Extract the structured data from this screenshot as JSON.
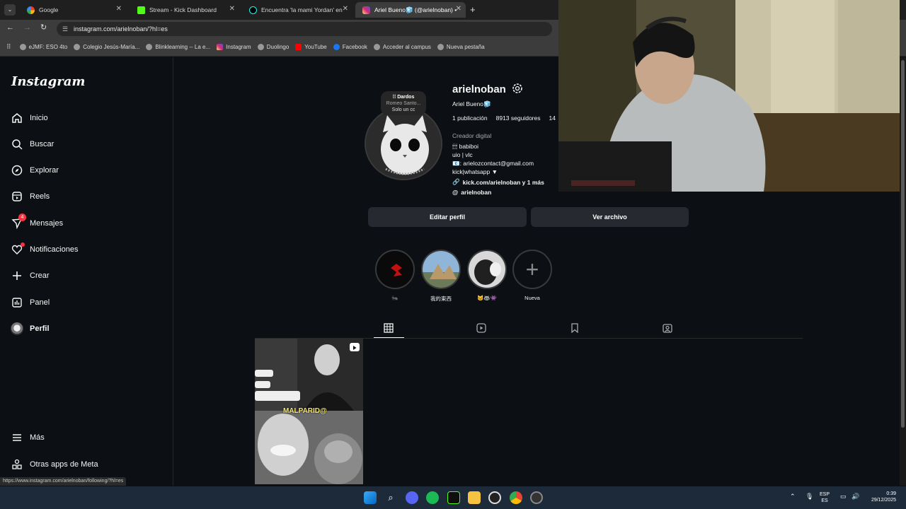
{
  "browser": {
    "tabs": [
      {
        "title": "Google",
        "favicon": "google-icon",
        "active": false
      },
      {
        "title": "Stream - Kick Dashboard",
        "favicon": "kick-icon",
        "active": false
      },
      {
        "title": "Encuentra 'la mami Yordan' en",
        "favicon": "tiktok-icon",
        "active": false
      },
      {
        "title": "Ariel Bueno🧊 (@arielnoban) •",
        "favicon": "instagram-icon",
        "active": true
      }
    ],
    "url": "instagram.com/arielnoban/?hl=es",
    "bookmarks": [
      "eJMF: ESO 4to",
      "Colegio Jesús-María...",
      "Blinklearning -- La e...",
      "Instagram",
      "Duolingo",
      "YouTube",
      "Facebook",
      "Acceder al campus",
      "Nueva pestaña"
    ],
    "status_url": "https://www.instagram.com/arielnoban/following/?hl=es"
  },
  "sidebar": {
    "logo": "Instagram",
    "items": [
      {
        "label": "Inicio",
        "icon": "home-icon"
      },
      {
        "label": "Buscar",
        "icon": "search-icon"
      },
      {
        "label": "Explorar",
        "icon": "compass-icon"
      },
      {
        "label": "Reels",
        "icon": "reels-icon"
      },
      {
        "label": "Mensajes",
        "icon": "messenger-icon",
        "badge": "4"
      },
      {
        "label": "Notificaciones",
        "icon": "heart-icon"
      },
      {
        "label": "Crear",
        "icon": "plus-icon"
      },
      {
        "label": "Panel",
        "icon": "chart-icon"
      },
      {
        "label": "Perfil",
        "icon": "avatar-icon"
      }
    ],
    "bottom": [
      {
        "label": "Más",
        "icon": "menu-icon"
      },
      {
        "label": "Otras apps de Meta",
        "icon": "meta-apps-icon"
      }
    ]
  },
  "profile": {
    "note": {
      "line1": "⁞⁞ Dardos",
      "line2": "Romeo Santo...",
      "line3": "Solo un cc"
    },
    "username": "arielnoban",
    "full_name": "Ariel Bueno🧊",
    "posts": "1 publicación",
    "followers": "8913 seguidores",
    "following_partial": "14",
    "category": "Creador digital",
    "bio": [
      "🕯🕯🕯 babiboi",
      "uio | vlc",
      "📧: arielozcontact@gmail.com",
      "kick|whatsapp ▼"
    ],
    "link": "kick.com/arielnoban y 1 más",
    "threads": "arielnoban",
    "edit_button": "Editar perfil",
    "archive_button": "Ver archivo",
    "highlights": [
      {
        "label": "🐜"
      },
      {
        "label": "我的東西"
      },
      {
        "label": "🐱🦝👾"
      },
      {
        "label": "Nueva"
      }
    ],
    "post_caption": "MALPARID@"
  },
  "taskbar": {
    "lang_top": "ESP",
    "lang_bottom": "ES",
    "time": "0:39",
    "date": "29/12/2025"
  },
  "colors": {
    "page_bg": "#0c1014",
    "button_bg": "#262a30",
    "badge_red": "#ff3040"
  }
}
